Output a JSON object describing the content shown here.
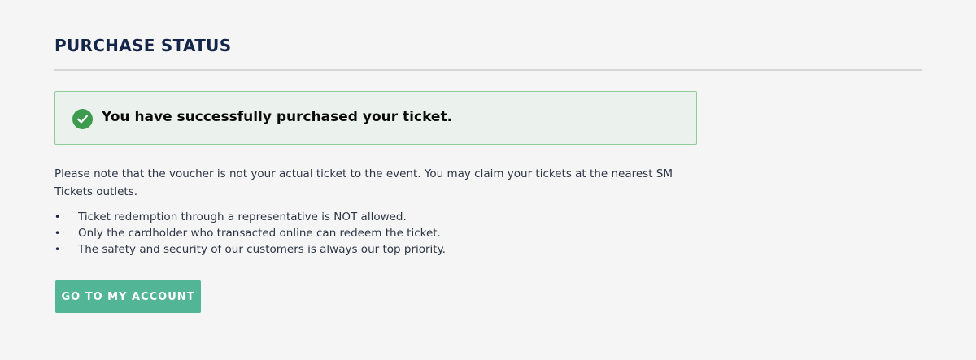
{
  "page": {
    "title": "PURCHASE STATUS"
  },
  "alert": {
    "message": "You have successfully purchased your ticket.",
    "icon": "check-circle-icon",
    "icon_color": "#3d9b4e",
    "border_color": "#8ecc98",
    "background": "#ebf2ed"
  },
  "note": {
    "text": "Please note that the voucher is not your actual ticket to the event. You may claim your tickets at the nearest SM Tickets outlets.",
    "items": [
      "Ticket redemption through a representative is NOT allowed.",
      "Only the cardholder who transacted online can redeem the ticket.",
      "The safety and security of our customers is always our top priority."
    ]
  },
  "actions": {
    "account_button_label": "GO TO MY ACCOUNT",
    "account_button_color": "#51b596"
  }
}
